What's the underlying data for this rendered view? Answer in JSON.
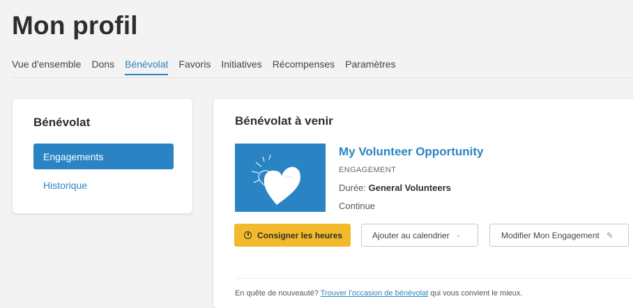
{
  "page": {
    "title": "Mon profil"
  },
  "tabs": [
    {
      "label": "Vue d'ensemble"
    },
    {
      "label": "Dons"
    },
    {
      "label": "Bénévolat",
      "active": true
    },
    {
      "label": "Favoris"
    },
    {
      "label": "Initiatives"
    },
    {
      "label": "Récompenses"
    },
    {
      "label": "Paramètres"
    }
  ],
  "sidebar": {
    "title": "Bénévolat",
    "items": [
      {
        "label": "Engagements",
        "active": true
      },
      {
        "label": "Historique"
      }
    ]
  },
  "main": {
    "title": "Bénévolat à venir",
    "opportunity": {
      "title": "My Volunteer Opportunity",
      "type": "ENGAGEMENT",
      "duration_label": "Durée: ",
      "duration_value": "General Volunteers",
      "frequency": "Continue",
      "image_icon": "heart-icon"
    },
    "buttons": {
      "log_hours": "Consigner les heures",
      "add_calendar": "Ajouter au calendrier",
      "edit_engagement": "Modifier Mon Engagement"
    },
    "footer": {
      "prefix": "En quête de nouveauté? ",
      "link": "Trouver l'occasion de bénévolat",
      "suffix": " qui vous convient le mieux."
    }
  },
  "colors": {
    "accent": "#2a84c3",
    "button_yellow": "#f2b92b",
    "background": "#f3f3f3"
  }
}
